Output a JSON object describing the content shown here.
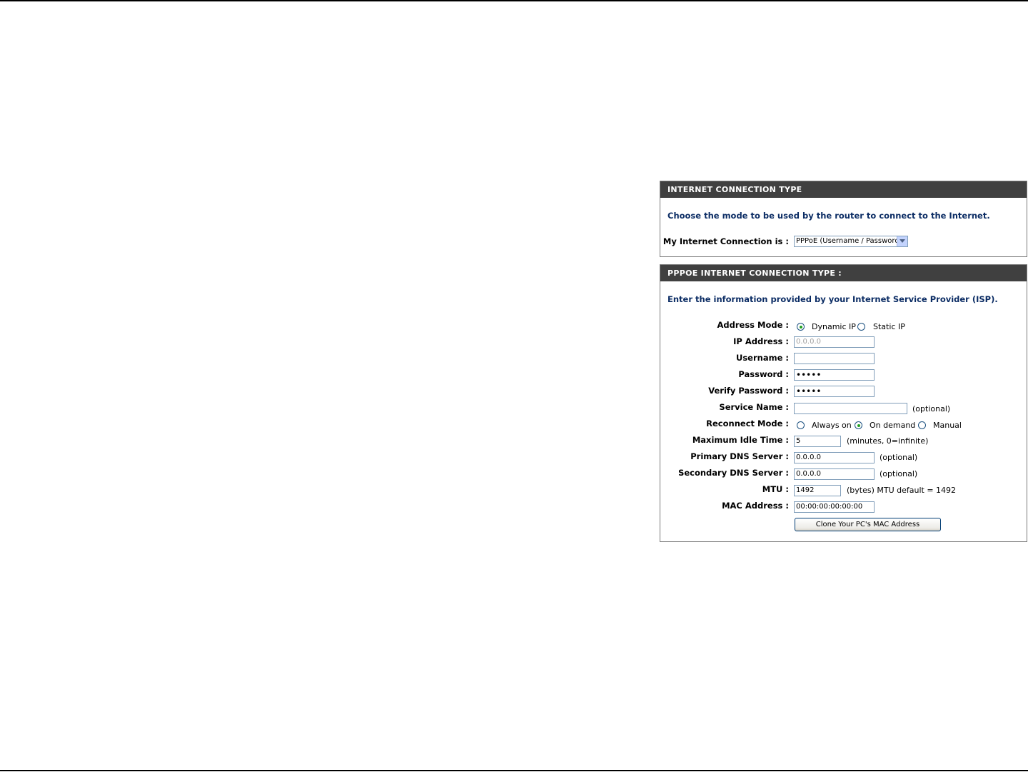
{
  "connection_panel": {
    "header": "INTERNET CONNECTION TYPE",
    "intro": "Choose the mode to be used by the router to connect to the Internet.",
    "connection_label": "My Internet Connection is :",
    "connection_value": "PPPoE (Username / Password)"
  },
  "pppoe_panel": {
    "header": "PPPOE INTERNET CONNECTION TYPE :",
    "intro": "Enter the information provided by your Internet Service Provider (ISP).",
    "address_mode": {
      "label": "Address Mode :",
      "options": [
        "Dynamic IP",
        "Static IP"
      ],
      "selected": "Dynamic IP"
    },
    "ip_address": {
      "label": "IP Address :",
      "value": "0.0.0.0"
    },
    "username": {
      "label": "Username :",
      "value": ""
    },
    "password": {
      "label": "Password :",
      "value": "•••••"
    },
    "verify_password": {
      "label": "Verify Password :",
      "value": "•••••"
    },
    "service_name": {
      "label": "Service Name :",
      "value": "",
      "note": "(optional)"
    },
    "reconnect_mode": {
      "label": "Reconnect Mode :",
      "options": [
        "Always on",
        "On demand",
        "Manual"
      ],
      "selected": "On demand"
    },
    "max_idle_time": {
      "label": "Maximum Idle Time :",
      "value": "5",
      "note": "(minutes, 0=infinite)"
    },
    "primary_dns": {
      "label": "Primary DNS Server :",
      "value": "0.0.0.0",
      "note": "(optional)"
    },
    "secondary_dns": {
      "label": "Secondary DNS Server :",
      "value": "0.0.0.0",
      "note": "(optional)"
    },
    "mtu": {
      "label": "MTU :",
      "value": "1492",
      "note": "(bytes) MTU default = 1492"
    },
    "mac_address": {
      "label": "MAC Address :",
      "value": "00:00:00:00:00:00"
    },
    "clone_button": "Clone Your PC's MAC Address"
  },
  "colors": {
    "header_bg": "#404040",
    "intro_text": "#0b2c64",
    "radio_selected": "#21a121"
  }
}
